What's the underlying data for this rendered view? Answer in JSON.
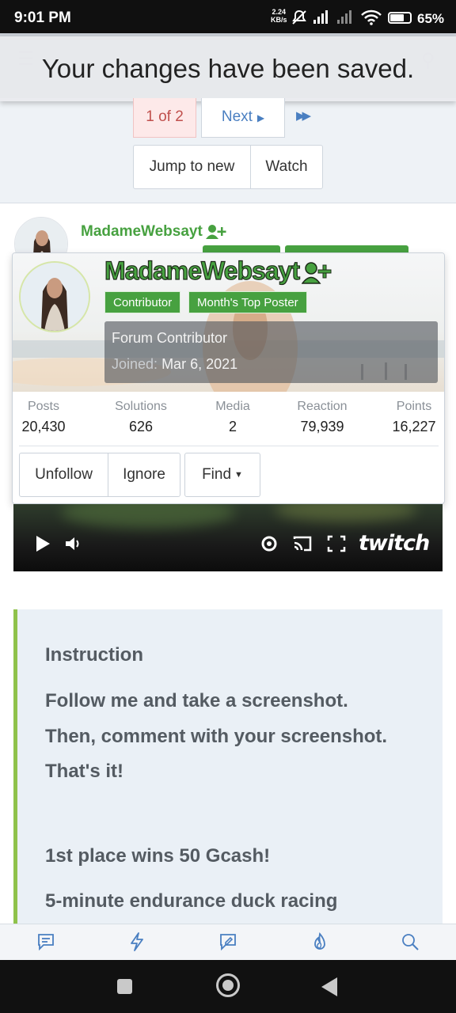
{
  "status_bar": {
    "time": "9:01 PM",
    "net_speed_value": "2.24",
    "net_speed_unit": "KB/s",
    "battery": "65%"
  },
  "notice": {
    "message": "Your changes have been saved."
  },
  "pagination": {
    "current": "1 of 2",
    "next": "Next"
  },
  "thread_actions": {
    "jump_to_new": "Jump to new",
    "watch": "Watch"
  },
  "post": {
    "username": "MadameWebsayt"
  },
  "member_card": {
    "username": "MadameWebsayt",
    "banners": [
      "Contributor",
      "Month's Top Poster"
    ],
    "user_title": "Forum Contributor",
    "joined_label": "Joined:",
    "joined_date": "Mar 6, 2021",
    "stats": [
      {
        "label": "Posts",
        "value": "20,430"
      },
      {
        "label": "Solutions",
        "value": "626"
      },
      {
        "label": "Media",
        "value": "2"
      },
      {
        "label": "Reaction",
        "value": "79,939"
      },
      {
        "label": "Points",
        "value": "16,227"
      }
    ],
    "buttons": {
      "unfollow": "Unfollow",
      "ignore": "Ignore",
      "find": "Find"
    }
  },
  "video": {
    "brand": "twitch"
  },
  "instruction": {
    "heading": "Instruction",
    "lines": [
      "Follow me and take a screenshot.",
      "Then, comment with your screenshot.",
      "That's it!",
      "1st place wins 50 Gcash!",
      "5-minute endurance duck racing"
    ]
  },
  "colors": {
    "accent_green": "#47a140",
    "link_blue": "#4a7fc1",
    "quote_border": "#8fc24b"
  },
  "icons": {
    "bottom_nav": [
      "new-posts-icon",
      "whats-new-icon",
      "new-thread-icon",
      "trending-icon",
      "search-icon"
    ],
    "video_controls": [
      "play-icon",
      "volume-icon",
      "settings-icon",
      "cast-icon",
      "fullscreen-icon"
    ]
  }
}
